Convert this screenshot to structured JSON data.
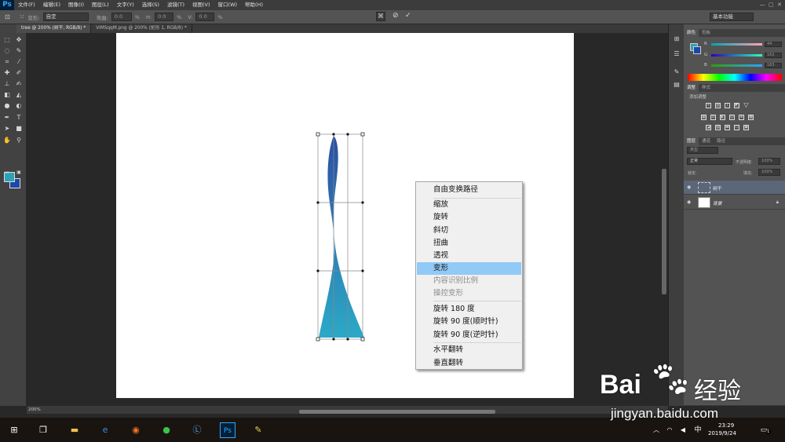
{
  "app": {
    "logo": "Ps"
  },
  "menu": [
    "文件(F)",
    "编辑(E)",
    "图像(I)",
    "图层(L)",
    "文字(Y)",
    "选择(S)",
    "滤镜(T)",
    "视图(V)",
    "窗口(W)",
    "帮助(H)"
  ],
  "options": {
    "mode_label": "变形:",
    "mode_value": "自定",
    "bend_label": "弯曲:",
    "bend_value": "0.0",
    "h_label": "H:",
    "h_value": "0.0",
    "v_label": "V:",
    "v_value": "0.0",
    "pct": "%",
    "workspace": "基本功能"
  },
  "tabs": [
    {
      "label": "tree @ 200% (树干, RGB/8) *",
      "active": true
    },
    {
      "label": "ViMSqqM.png @ 200% (矩形 1, RGB/8) *",
      "active": false
    }
  ],
  "context_menu": {
    "items": [
      {
        "label": "自由变换路径",
        "state": "normal"
      },
      {
        "label": "缩放",
        "state": "normal"
      },
      {
        "label": "旋转",
        "state": "normal"
      },
      {
        "label": "斜切",
        "state": "normal"
      },
      {
        "label": "扭曲",
        "state": "normal"
      },
      {
        "label": "透视",
        "state": "normal"
      },
      {
        "label": "变形",
        "state": "highlight"
      },
      {
        "label": "内容识别比例",
        "state": "disabled"
      },
      {
        "label": "操控变形",
        "state": "disabled"
      },
      {
        "label": "旋转 180 度",
        "state": "normal"
      },
      {
        "label": "旋转 90 度(顺时针)",
        "state": "normal"
      },
      {
        "label": "旋转 90 度(逆时针)",
        "state": "normal"
      },
      {
        "label": "水平翻转",
        "state": "normal"
      },
      {
        "label": "垂直翻转",
        "state": "normal"
      }
    ]
  },
  "panels": {
    "color_tabs": [
      "颜色",
      "色板"
    ],
    "color_sliders": [
      {
        "label": "R",
        "value": "44"
      },
      {
        "label": "G",
        "value": "162"
      },
      {
        "label": "B",
        "value": "183"
      }
    ],
    "adjust_tabs": [
      "调整",
      "样式"
    ],
    "adjust_hint": "添加调整",
    "layers_tabs": [
      "图层",
      "通道",
      "路径"
    ],
    "layers_filter": "类型",
    "blend_mode": "正常",
    "opacity_label": "不透明度:",
    "opacity_value": "100%",
    "lock_label": "锁定:",
    "fill_label": "填充:",
    "fill_value": "100%",
    "layers": [
      {
        "name": "树干",
        "selected": true
      },
      {
        "name": "背景",
        "selected": false
      }
    ]
  },
  "status": {
    "zoom": "200%"
  },
  "taskbar": {
    "ime": "中",
    "time": "23:29",
    "date": "2019/9/24",
    "notification_count": "1"
  },
  "watermark": {
    "brand": "Bai",
    "suffix": "经验",
    "url": "jingyan.baidu.com"
  },
  "colors": {
    "accent": "#91c9f7",
    "fg_swatch": "#2ca2b7",
    "bg_swatch": "#1d48a8",
    "shape_top": "#2c4fa3",
    "shape_bottom": "#2ca9c6"
  }
}
